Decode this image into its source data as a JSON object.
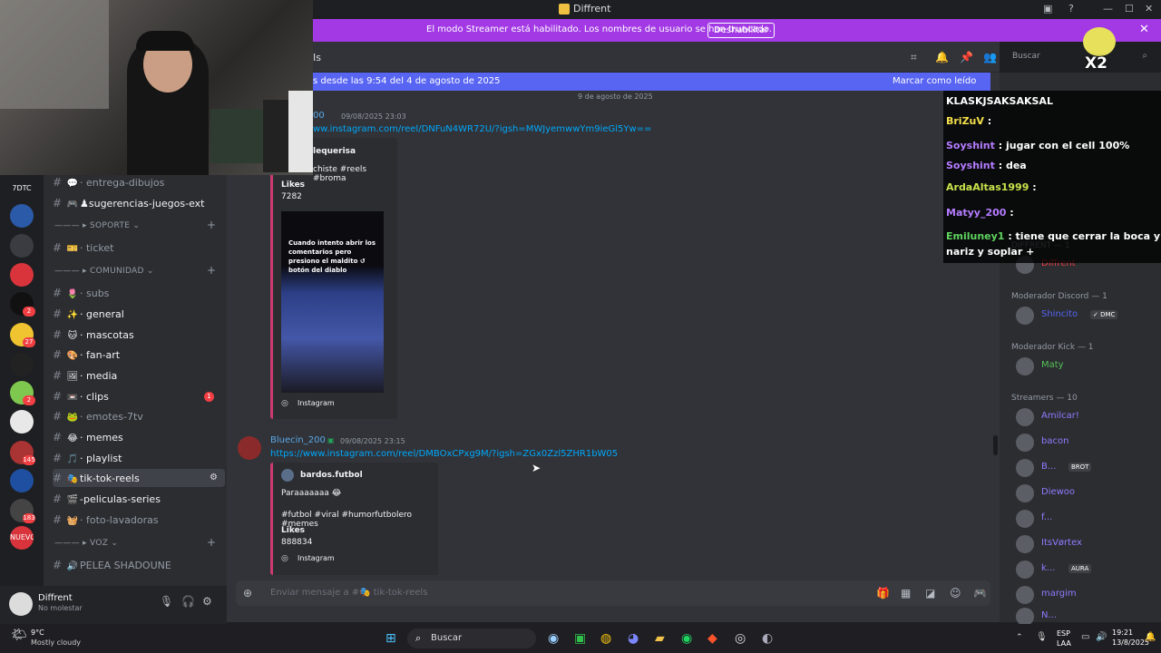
{
  "window": {
    "title": "Diffrent",
    "controls": [
      "—",
      "☐",
      "✕"
    ]
  },
  "streamer_bar": {
    "message": "El modo Streamer está habilitado. Los nombres de usuario se han truncado.",
    "button": "Deshabilitar"
  },
  "servers": [
    {
      "label": "",
      "color": "#3a3c42"
    },
    {
      "label": "7DTC",
      "color": "#1e1f22"
    },
    {
      "label": "",
      "color": "#2a5aa8"
    },
    {
      "label": "",
      "color": "#3a3c42"
    },
    {
      "label": "",
      "color": "#d9343c"
    },
    {
      "label": "",
      "color": "#111",
      "badge": "2"
    },
    {
      "label": "",
      "color": "#f0c430",
      "badge": "27"
    },
    {
      "label": "",
      "color": "#222"
    },
    {
      "label": "",
      "color": "#7ec850",
      "badge": "2"
    },
    {
      "label": "",
      "color": "#e8e8e8"
    },
    {
      "label": "",
      "color": "#a33",
      "badge": "145"
    },
    {
      "label": "",
      "color": "#1f4fa0"
    },
    {
      "label": "",
      "color": "#444",
      "badge": "183"
    },
    {
      "label": "NUEVO",
      "color": "#d9343c"
    }
  ],
  "channels": [
    {
      "icon": "💬",
      "name": "· entrega-dibujos",
      "muted": true
    },
    {
      "icon": "🎮",
      "name": "♟sugerencias-juegos-ext",
      "muted": false
    },
    {
      "category": "——— ▸ SOPORTE ⌄"
    },
    {
      "icon": "🎫",
      "name": "· ticket",
      "muted": true
    },
    {
      "category": "——— ▸ COMUNIDAD ⌄"
    },
    {
      "icon": "🌷",
      "name": "· subs",
      "muted": true
    },
    {
      "icon": "✨",
      "name": "· general",
      "muted": false
    },
    {
      "icon": "🐱",
      "name": "· mascotas",
      "muted": false
    },
    {
      "icon": "🎨",
      "name": "· fan-art",
      "muted": false
    },
    {
      "icon": "🖼",
      "name": "· media",
      "muted": false
    },
    {
      "icon": "📼",
      "name": "· clips",
      "muted": false,
      "badge": "1"
    },
    {
      "icon": "🐸",
      "name": "· emotes-7tv",
      "muted": true
    },
    {
      "icon": "😂",
      "name": "· memes",
      "muted": false
    },
    {
      "icon": "🎵",
      "name": "· playlist",
      "muted": false
    },
    {
      "icon": "🎭",
      "name": "tik-tok-reels",
      "muted": false,
      "active": true
    },
    {
      "icon": "🎬",
      "name": "-peliculas-series",
      "muted": false
    },
    {
      "icon": "🧺",
      "name": "· foto-lavadoras",
      "muted": true
    },
    {
      "category": "——— ▸ VOZ ⌄"
    },
    {
      "icon": "🔊",
      "name": "PELEA SHADOUNE",
      "muted": true
    }
  ],
  "user_panel": {
    "name": "Diffrent",
    "status": "No molestar"
  },
  "chat": {
    "channel_label": "Is",
    "new_messages": "s desde las 9:54 del 4 de agosto de 2025",
    "mark_read": "Marcar como leído",
    "date_separator": "9 de agosto de 2025",
    "msg1": {
      "author": "00",
      "time": "09/08/2025 23:03",
      "link": "ww.instagram.com/reel/DNFuN4WR72U/?igsh=MWJyemwwYm9ieGl5Yw==",
      "embed_author": "lequerisa",
      "embed_desc": "chiste #reels #broma",
      "likes_label": "Likes",
      "likes": "7282",
      "thumb_text": "Cuando intento abrir los comentarios pero presiono el maldito ↺ botón del diablo",
      "source": "Instagram"
    },
    "msg2": {
      "author": "Bluecin_200",
      "time": "09/08/2025 23:15",
      "link": "https://www.instagram.com/reel/DMBOxCPxg9M/?igsh=ZGx0Zzl5ZHR1bW05",
      "embed_author": "bardos.futbol",
      "embed_desc1": "Paraaaaaaa 😂",
      "embed_desc2": "#futbol #viral #humorfutbolero #memes",
      "likes_label": "Likes",
      "likes": "888834",
      "source": "Instagram"
    },
    "composer_placeholder": "Enviar mensaje a #🎭 tik-tok-reels"
  },
  "header_search": "Buscar",
  "members": {
    "groups": [
      {
        "label": "DIFFRENT — 1"
      },
      {
        "label": "Moderador Discord — 1"
      },
      {
        "label": "Moderador Kick — 1"
      },
      {
        "label": "Streamers — 10"
      }
    ],
    "list": [
      {
        "name": "Diffrent",
        "color": "#f23f43",
        "group": 0
      },
      {
        "name": "Shincito",
        "color": "#5865f2",
        "tag": "✓ DMC",
        "group": 1
      },
      {
        "name": "Maty",
        "color": "#57c157",
        "group": 2
      },
      {
        "name": "Amilcar!",
        "color": "#8e7cff",
        "group": 3
      },
      {
        "name": "bacon",
        "color": "#8e7cff"
      },
      {
        "name": "B...",
        "color": "#8e7cff",
        "tag": "BROT"
      },
      {
        "name": "Diewoo",
        "color": "#8e7cff"
      },
      {
        "name": "f...",
        "color": "#8e7cff"
      },
      {
        "name": "ItsVørtex",
        "color": "#8e7cff"
      },
      {
        "name": "k...",
        "color": "#8e7cff",
        "tag": "AURA"
      },
      {
        "name": "margim",
        "color": "#8e7cff"
      },
      {
        "name": "N...",
        "color": "#8e7cff"
      }
    ]
  },
  "overlay": {
    "multiplier": "X2",
    "lines": [
      {
        "user": "KLASKJSAKSAKSAL",
        "text": "",
        "cls": ""
      },
      {
        "user": "BriZuV",
        "text": ":",
        "cls": "u"
      },
      {
        "user": "Soyshint",
        "text": ": jugar con el cell 100%",
        "cls": "u2"
      },
      {
        "user": "Soyshint",
        "text": ": dea",
        "cls": "u2"
      },
      {
        "user": "ArdaAltas1999",
        "text": ":",
        "cls": "u3"
      },
      {
        "user": "Matyy_200",
        "text": ":",
        "cls": "u2"
      },
      {
        "user": "Emiluney1",
        "text": ": tiene que cerrar la boca y la",
        "cls": "u4"
      },
      {
        "user": "",
        "text": "nariz y soplar +",
        "cls": ""
      }
    ]
  },
  "taskbar": {
    "weather_temp": "9°C",
    "weather_text": "Mostly cloudy",
    "search": "Buscar",
    "lang1": "ESP",
    "lang2": "LAA",
    "time": "19:21",
    "date": "13/8/2025"
  }
}
